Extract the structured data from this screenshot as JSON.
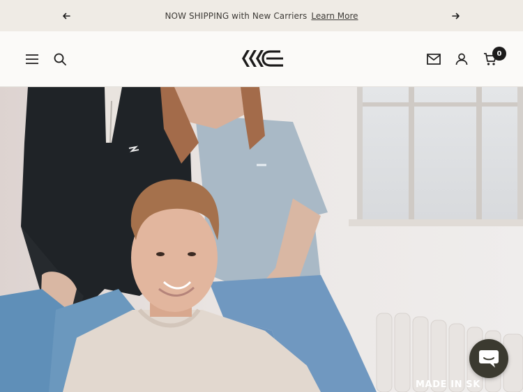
{
  "announcement": {
    "message": "NOW SHIPPING with New Carriers",
    "link_label": "Learn More",
    "prev_icon": "arrow-left-icon",
    "next_icon": "arrow-right-icon"
  },
  "header": {
    "menu_icon": "hamburger-menu-icon",
    "search_icon": "search-icon",
    "logo_icon": "brand-logo",
    "mail_icon": "mail-icon",
    "account_icon": "account-icon",
    "cart_icon": "cart-icon",
    "cart_count": "0"
  },
  "hero": {
    "caption": "MADE IN SK",
    "image": "three people wearing brand apparel"
  },
  "chat": {
    "icon": "chat-bubble-icon"
  },
  "colors": {
    "announcement_bg": "#efebe5",
    "header_bg": "#fbfaf8",
    "text": "#1c1b1b",
    "chat_bg": "#3b3a30"
  }
}
